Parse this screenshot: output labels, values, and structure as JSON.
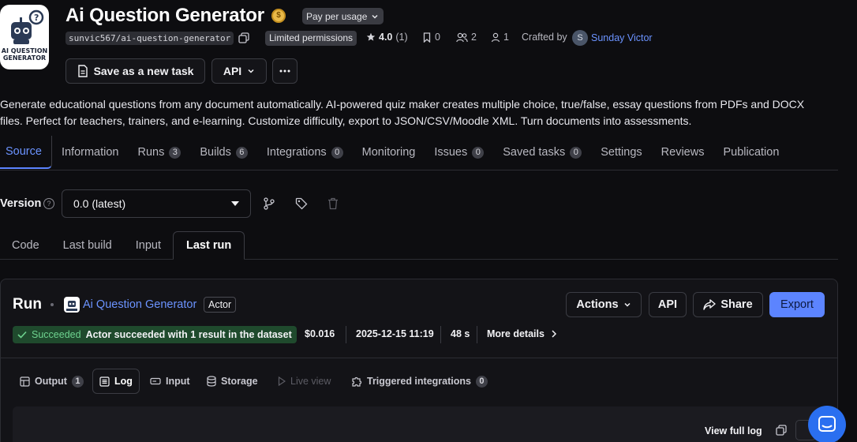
{
  "header": {
    "logo_text": "AI QUESTION GENERATOR",
    "title": "Ai Question Generator",
    "pricing_label": "Pay per usage",
    "slug": "sunvic567/ai-question-generator",
    "permissions": "Limited permissions",
    "rating": "4.0",
    "rating_count": "(1)",
    "bookmarks": "0",
    "users": "2",
    "monthly_users": "1",
    "crafted_by_label": "Crafted by",
    "creator_initial": "S",
    "creator_name": "Sunday Victor"
  },
  "toolbar": {
    "save_label": "Save as a new task",
    "api_label": "API"
  },
  "description": "Generate educational questions from any document automatically. AI-powered quiz maker creates multiple choice, true/false, essay questions from PDFs and DOCX files. Perfect for teachers, trainers, and e-learning. Customize difficulty, export to JSON/CSV/Moodle XML. Turn documents into assessments.",
  "tabs": [
    {
      "label": "Source",
      "count": null
    },
    {
      "label": "Information",
      "count": null
    },
    {
      "label": "Runs",
      "count": "3"
    },
    {
      "label": "Builds",
      "count": "6"
    },
    {
      "label": "Integrations",
      "count": "0"
    },
    {
      "label": "Monitoring",
      "count": null
    },
    {
      "label": "Issues",
      "count": "0"
    },
    {
      "label": "Saved tasks",
      "count": "0"
    },
    {
      "label": "Settings",
      "count": null
    },
    {
      "label": "Reviews",
      "count": null
    },
    {
      "label": "Publication",
      "count": null
    }
  ],
  "version": {
    "label": "Version",
    "selected": "0.0 (latest)"
  },
  "subtabs": [
    "Code",
    "Last build",
    "Input",
    "Last run"
  ],
  "run": {
    "title": "Run",
    "actor_name": "Ai Question Generator",
    "actor_badge": "Actor",
    "actions_label": "Actions",
    "api_label": "API",
    "share_label": "Share",
    "export_label": "Export",
    "status_label": "Succeeded",
    "status_message": "Actor succeeded with 1 result in the dataset",
    "cost": "$0.016",
    "started": "2025-12-15 11:19",
    "duration": "48 s",
    "more_details": "More details"
  },
  "output_tabs": {
    "output": "Output",
    "output_count": "1",
    "log": "Log",
    "input": "Input",
    "storage": "Storage",
    "live_view": "Live view",
    "triggered": "Triggered integrations",
    "triggered_count": "0"
  },
  "log": {
    "view_full_log": "View full log"
  },
  "colors": {
    "accent": "#5c84ff",
    "link": "#6b93ff",
    "success_bg": "#1f4a2d",
    "success_text": "#6ed38f"
  }
}
